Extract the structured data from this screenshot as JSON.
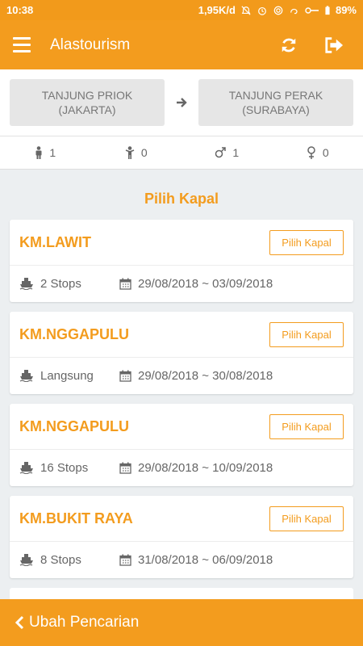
{
  "status_bar": {
    "time": "10:38",
    "network_speed": "1,95K/d",
    "battery": "89%"
  },
  "app_bar": {
    "title": "Alastourism",
    "menu_icon": "hamburger-menu-icon",
    "refresh_icon": "refresh-icon",
    "logout_icon": "logout-icon"
  },
  "route": {
    "origin_line1": "TANJUNG PRIOK",
    "origin_line2": "(JAKARTA)",
    "destination_line1": "TANJUNG PERAK",
    "destination_line2": "(SURABAYA)"
  },
  "passengers": {
    "adult": "1",
    "child": "0",
    "male": "1",
    "female": "0"
  },
  "section_title": "Pilih Kapal",
  "ships": [
    {
      "name": "KM.LAWIT",
      "button": "Pilih Kapal",
      "stops": "2 Stops",
      "dates": "29/08/2018 ~ 03/09/2018"
    },
    {
      "name": "KM.NGGAPULU",
      "button": "Pilih Kapal",
      "stops": "Langsung",
      "dates": "29/08/2018 ~ 30/08/2018"
    },
    {
      "name": "KM.NGGAPULU",
      "button": "Pilih Kapal",
      "stops": "16 Stops",
      "dates": "29/08/2018 ~ 10/09/2018"
    },
    {
      "name": "KM.BUKIT RAYA",
      "button": "Pilih Kapal",
      "stops": "8 Stops",
      "dates": "31/08/2018 ~ 06/09/2018"
    }
  ],
  "bottom_bar": {
    "label": "Ubah Pencarian"
  },
  "colors": {
    "accent": "#f39c1e",
    "background": "#eceff1"
  }
}
